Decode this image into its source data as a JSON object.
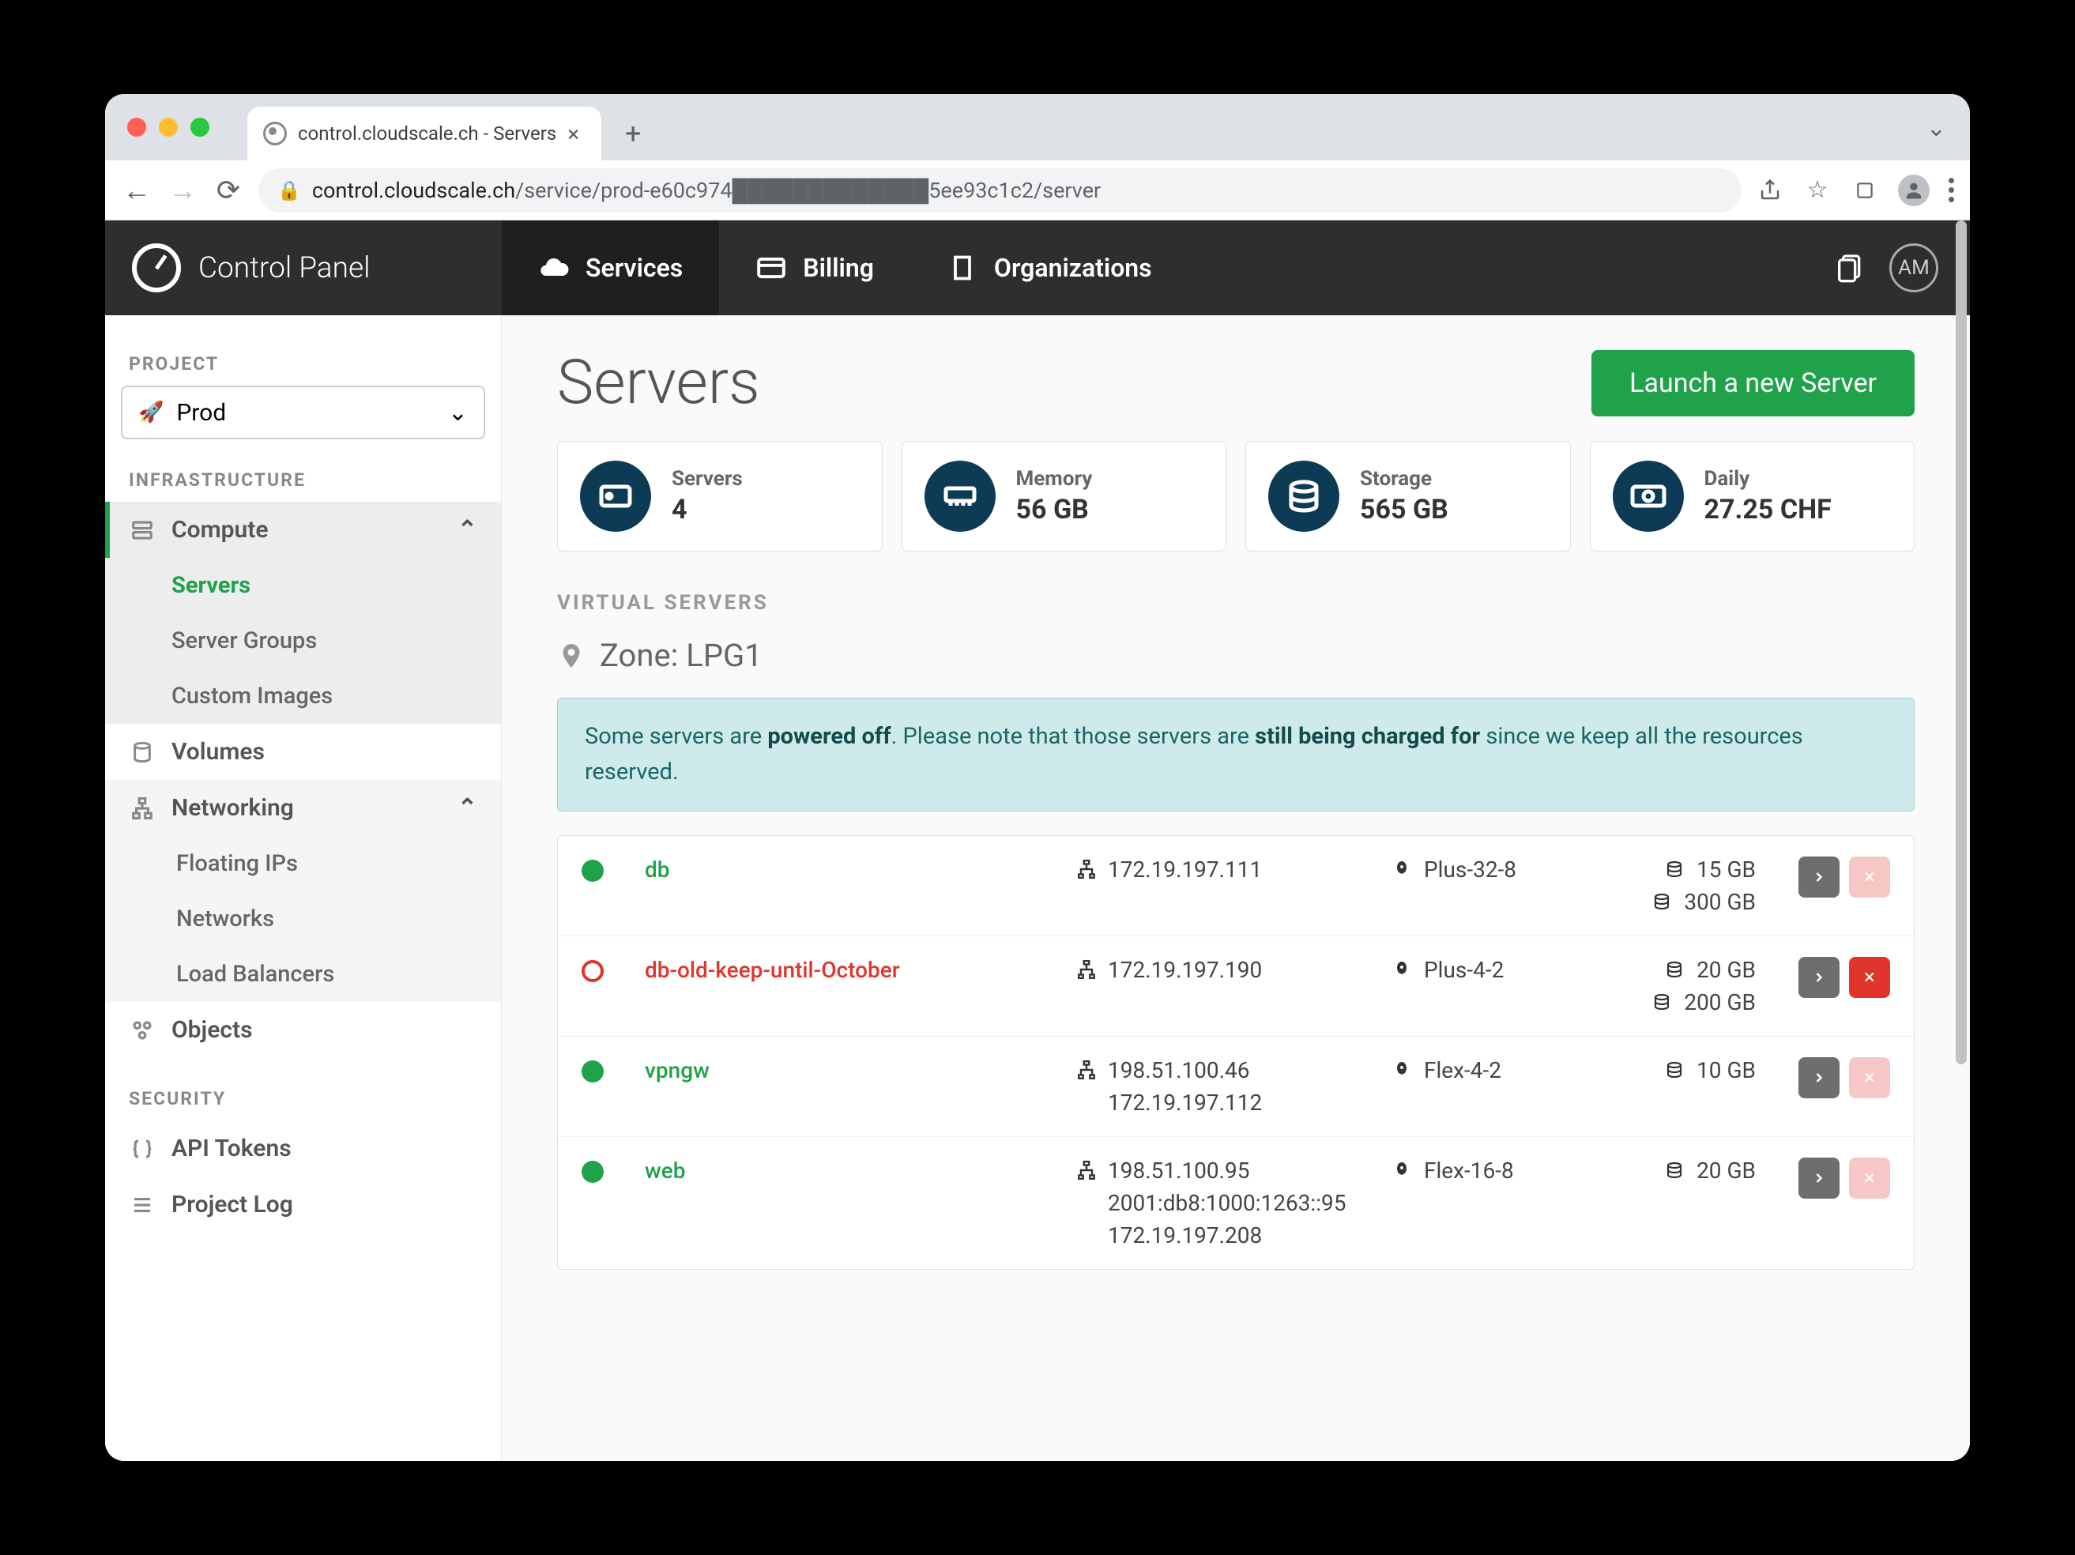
{
  "browser": {
    "tab_title": "control.cloudscale.ch - Servers",
    "url_host": "control.cloudscale.ch",
    "url_path": "/service/prod-e60c974█████████████5ee93c1c2/server"
  },
  "topbar": {
    "brand": "Control Panel",
    "nav": {
      "services": "Services",
      "billing": "Billing",
      "organizations": "Organizations"
    },
    "avatar": "AM"
  },
  "sidebar": {
    "project_label": "PROJECT",
    "project_value": "Prod",
    "infra_label": "INFRASTRUCTURE",
    "compute": "Compute",
    "servers": "Servers",
    "server_groups": "Server Groups",
    "custom_images": "Custom Images",
    "volumes": "Volumes",
    "networking": "Networking",
    "floating_ips": "Floating IPs",
    "networks": "Networks",
    "load_balancers": "Load Balancers",
    "objects": "Objects",
    "security_label": "SECURITY",
    "api_tokens": "API Tokens",
    "project_log": "Project Log"
  },
  "main": {
    "title": "Servers",
    "launch_label": "Launch a new Server",
    "stats": {
      "servers_label": "Servers",
      "servers_value": "4",
      "memory_label": "Memory",
      "memory_value": "56 GB",
      "storage_label": "Storage",
      "storage_value": "565 GB",
      "daily_label": "Daily",
      "daily_value": "27.25 CHF"
    },
    "subsection": "VIRTUAL SERVERS",
    "zone_prefix": "Zone: ",
    "zone": "LPG1",
    "banner": {
      "p1": "Some servers are ",
      "b1": "powered off",
      "p2": ". Please note that those servers are ",
      "b2": "still being charged for",
      "p3": " since we keep all the resources reserved."
    },
    "servers": [
      {
        "name": "db",
        "status": "running",
        "ips": [
          "172.19.197.111"
        ],
        "flavor": "Plus-32-8",
        "disks": [
          "15 GB",
          "300 GB"
        ],
        "deletable": false
      },
      {
        "name": "db-old-keep-until-October",
        "status": "stopped",
        "ips": [
          "172.19.197.190"
        ],
        "flavor": "Plus-4-2",
        "disks": [
          "20 GB",
          "200 GB"
        ],
        "deletable": true
      },
      {
        "name": "vpngw",
        "status": "running",
        "ips": [
          "198.51.100.46",
          "172.19.197.112"
        ],
        "flavor": "Flex-4-2",
        "disks": [
          "10 GB"
        ],
        "deletable": false
      },
      {
        "name": "web",
        "status": "running",
        "ips": [
          "198.51.100.95",
          "2001:db8:1000:1263::95",
          "172.19.197.208"
        ],
        "flavor": "Flex-16-8",
        "disks": [
          "20 GB"
        ],
        "deletable": false
      }
    ]
  }
}
